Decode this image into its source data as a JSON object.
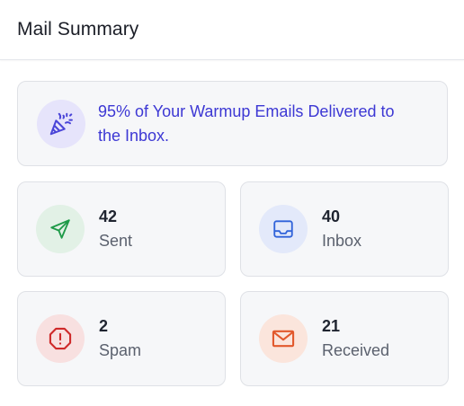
{
  "header": {
    "title": "Mail Summary"
  },
  "banner": {
    "text": "95% of Your Warmup Emails Delivered to the Inbox.",
    "icon": "party-popper-icon",
    "color": "#3d38d4"
  },
  "stats": [
    {
      "value": "42",
      "label": "Sent",
      "icon": "send-icon",
      "color": "#1e9a48"
    },
    {
      "value": "40",
      "label": "Inbox",
      "icon": "inbox-icon",
      "color": "#2f62d9"
    },
    {
      "value": "2",
      "label": "Spam",
      "icon": "spam-octagon-icon",
      "color": "#cf2a2a"
    },
    {
      "value": "21",
      "label": "Received",
      "icon": "envelope-icon",
      "color": "#e2582c"
    }
  ]
}
